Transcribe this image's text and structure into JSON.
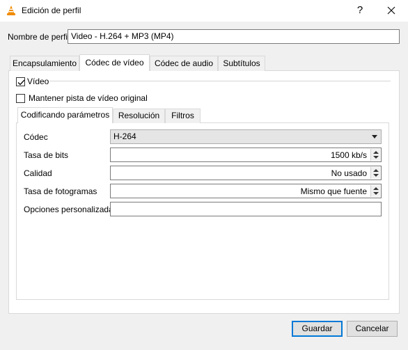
{
  "window": {
    "title": "Edición de perfil",
    "help_label": "?",
    "icon": "vlc-cone-icon"
  },
  "profile": {
    "label": "Nombre de perfil",
    "value": "Video - H.264 + MP3 (MP4)"
  },
  "tabs": [
    {
      "label": "Encapsulamiento",
      "active": false
    },
    {
      "label": "Códec de vídeo",
      "active": true
    },
    {
      "label": "Códec de audio",
      "active": false
    },
    {
      "label": "Subtítulos",
      "active": false
    }
  ],
  "video": {
    "enable_label": "Vídeo",
    "enable_checked": true,
    "keep_track_label": "Mantener pista de vídeo original",
    "keep_track_checked": false
  },
  "subtabs": [
    {
      "label": "Codificando parámetros",
      "active": true
    },
    {
      "label": "Resolución",
      "active": false
    },
    {
      "label": "Filtros",
      "active": false
    }
  ],
  "fields": {
    "codec": {
      "label": "Códec",
      "value": "H-264"
    },
    "bitrate": {
      "label": "Tasa de bits",
      "value": "1500 kb/s"
    },
    "quality": {
      "label": "Calidad",
      "value": "No usado"
    },
    "framerate": {
      "label": "Tasa de fotogramas",
      "value": "Mismo que fuente"
    },
    "custom": {
      "label": "Opciones personalizadas",
      "value": ""
    }
  },
  "buttons": {
    "save": "Guardar",
    "cancel": "Cancelar"
  },
  "colors": {
    "accent": "#0078d7",
    "vlc_orange": "#f08a00"
  }
}
